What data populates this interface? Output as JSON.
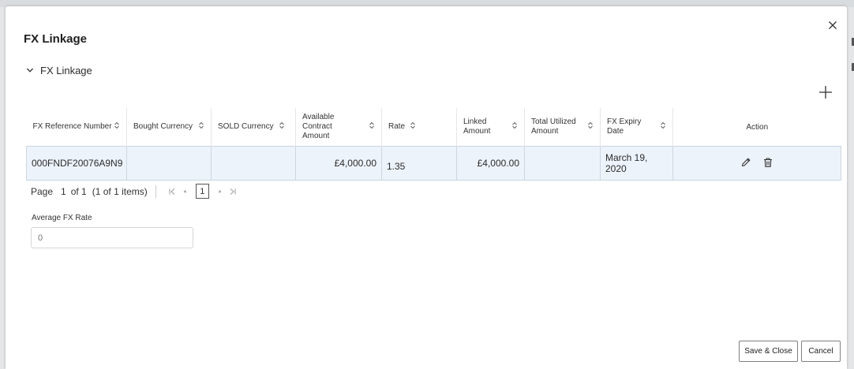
{
  "modal": {
    "title": "FX Linkage",
    "section_title": "FX Linkage"
  },
  "table": {
    "columns": [
      {
        "key": "ref",
        "label": "FX Reference Number"
      },
      {
        "key": "bought",
        "label": "Bought Currency"
      },
      {
        "key": "sold",
        "label": "SOLD Currency"
      },
      {
        "key": "available",
        "label": "Available Contract Amount"
      },
      {
        "key": "rate",
        "label": "Rate"
      },
      {
        "key": "linked",
        "label": "Linked Amount"
      },
      {
        "key": "utilized",
        "label": "Total Utilized Amount"
      },
      {
        "key": "expiry",
        "label": "FX Expiry Date"
      },
      {
        "key": "action",
        "label": "Action"
      }
    ],
    "rows": [
      {
        "ref": "000FNDF20076A9N9",
        "bought": "",
        "sold": "",
        "available": "£4,000.00",
        "rate": "1.35",
        "linked": "£4,000.00",
        "utilized": "",
        "expiry": "March 19, 2020"
      }
    ]
  },
  "pager": {
    "page_label": "Page",
    "current_page": "1",
    "of_label": "of 1",
    "items_label": "(1 of 1 items)",
    "page_box": "1"
  },
  "avg_fx_rate": {
    "label": "Average FX Rate",
    "placeholder": "0"
  },
  "buttons": {
    "save_close": "Save & Close",
    "cancel": "Cancel"
  },
  "icons": {
    "close": "close-icon",
    "collapse": "chevron-down-icon",
    "add": "plus-icon",
    "sort": "sort-icon",
    "edit": "pencil-icon",
    "delete": "trash-icon"
  }
}
